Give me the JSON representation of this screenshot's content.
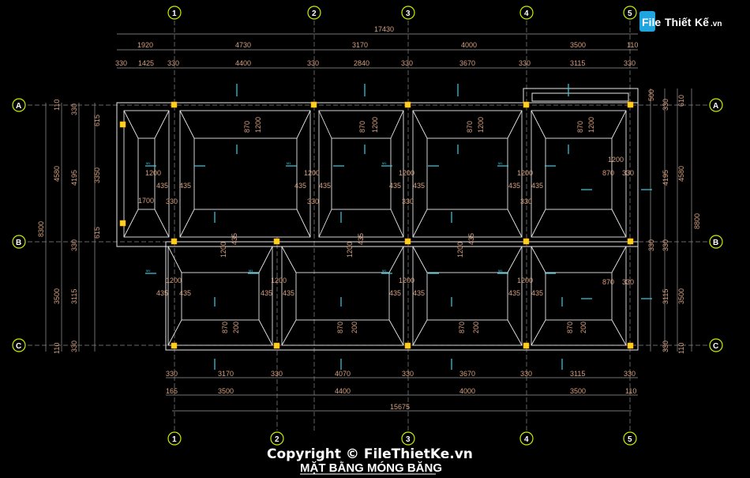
{
  "logo": {
    "brand": "File",
    "middle": "Thiết",
    "tail": "Kế",
    "domain": ".vn"
  },
  "drawing_title": "MẶT BẰNG MÓNG BĂNG",
  "copyright": "Copyright © FileThietKe.vn",
  "grid_axes": {
    "columns": [
      "1",
      "2",
      "3",
      "4",
      "5"
    ],
    "rows": [
      "A",
      "B",
      "C"
    ]
  },
  "dims_top": {
    "overall": "17430",
    "row1": [
      "1920",
      "4730",
      "3170",
      "4000",
      "3500",
      "110"
    ],
    "row2": [
      "330",
      "1425",
      "330",
      "4400",
      "330",
      "2840",
      "330",
      "3670",
      "330",
      "3115",
      "330"
    ]
  },
  "dims_bottom": {
    "row1": [
      "330",
      "3170",
      "330",
      "4070",
      "330",
      "3670",
      "330",
      "3115",
      "330"
    ],
    "row2": [
      "165",
      "3500",
      "4400",
      "4000",
      "3500",
      "110"
    ],
    "overall": "15675"
  },
  "dims_left": {
    "outer": "8300",
    "mid": [
      "4580",
      "3500"
    ],
    "inner": [
      "110",
      "4195",
      "330",
      "3115",
      "110"
    ],
    "detail": [
      "330",
      "615",
      "3350",
      "615",
      "330",
      "330"
    ]
  },
  "dims_right": {
    "outer": "8800",
    "mid": [
      "4580",
      "3500"
    ],
    "inner": [
      "610",
      "4195",
      "330",
      "3115",
      "110"
    ],
    "detail": [
      "500",
      "330",
      "330",
      "330"
    ]
  },
  "inner_dims": {
    "w1200": "1200",
    "w435": "435",
    "w870": "870",
    "w330": "330",
    "w1700": "1700",
    "w200": "200",
    "tag": "M1"
  }
}
